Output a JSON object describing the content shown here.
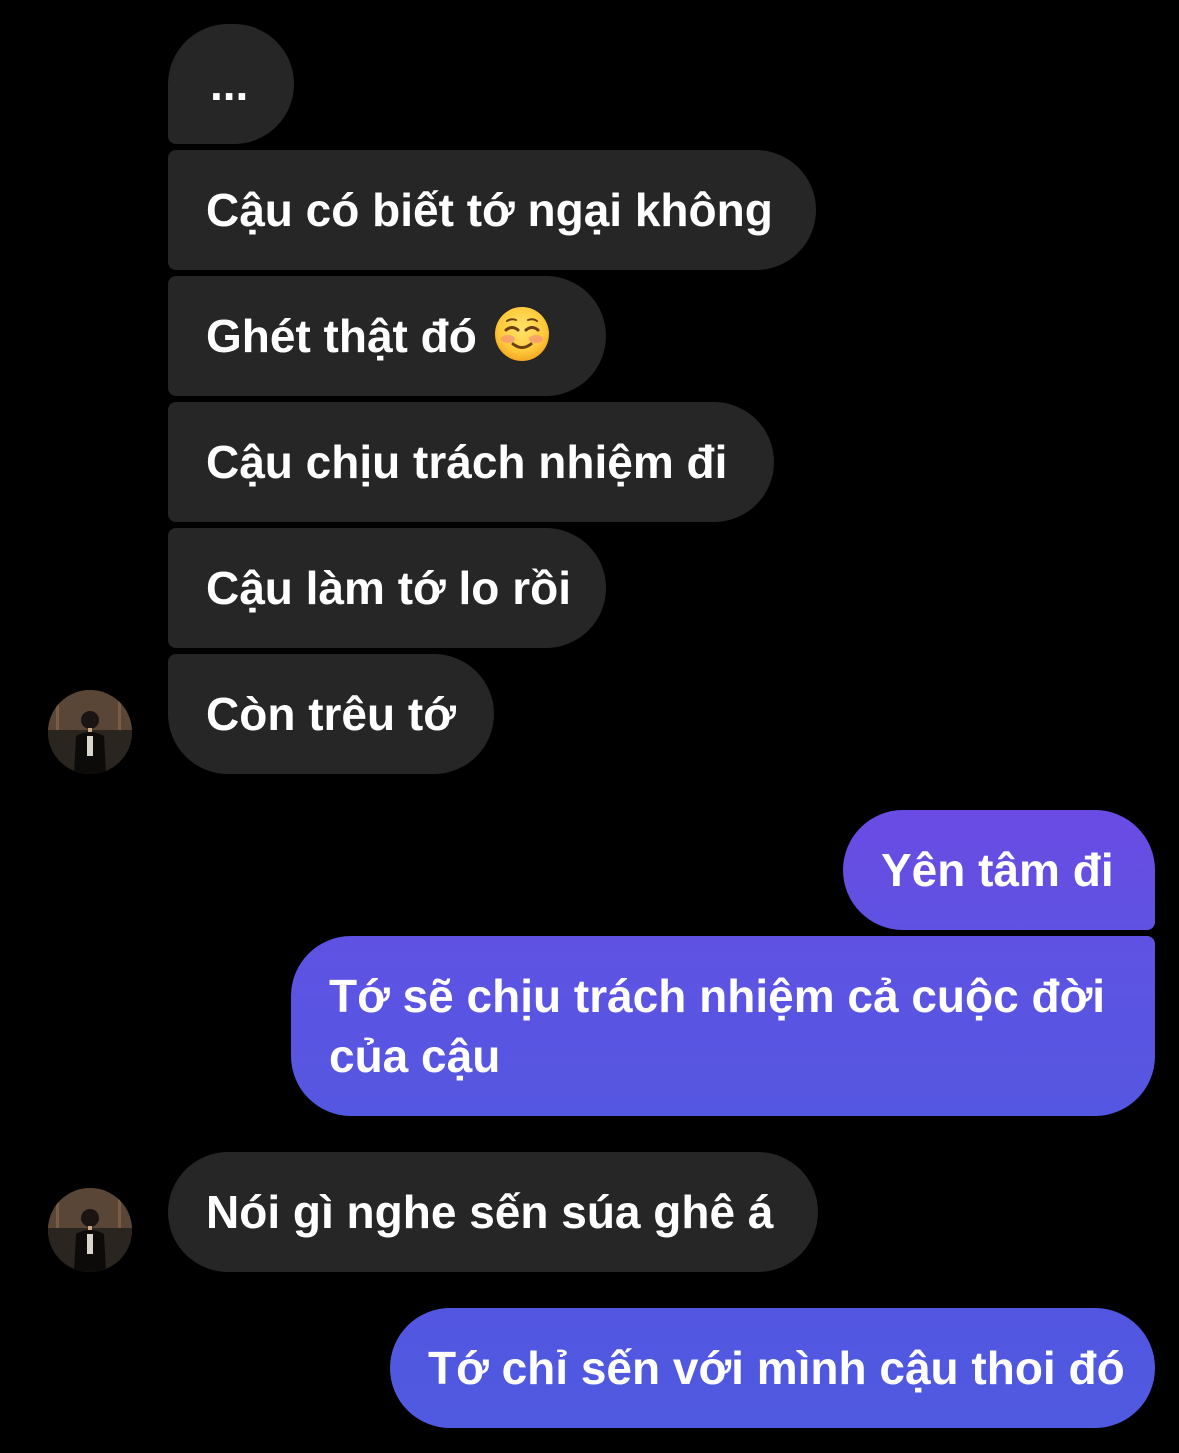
{
  "conversation": {
    "messages": [
      {
        "from": "them",
        "text": "..."
      },
      {
        "from": "them",
        "text": "Cậu có biết tớ ngại không"
      },
      {
        "from": "them",
        "text": "Ghét thật đó",
        "emoji": "smiling-face-with-blush-emoji"
      },
      {
        "from": "them",
        "text": "Cậu chịu trách nhiệm đi"
      },
      {
        "from": "them",
        "text": "Cậu làm tớ lo rồi"
      },
      {
        "from": "them",
        "text": "Còn trêu tớ"
      },
      {
        "from": "me",
        "text": "Yên tâm đi"
      },
      {
        "from": "me",
        "text_line1": "Tớ sẽ chịu trách nhiệm cả cuộc đời",
        "text_line2": "của cậu"
      },
      {
        "from": "them",
        "text": "Nói gì nghe sến súa ghê á"
      },
      {
        "from": "me",
        "text": "Tớ chỉ sến với mình cậu thoi đó"
      }
    ]
  },
  "colors": {
    "background": "#000000",
    "incoming_bubble": "#262626",
    "outgoing_gradient_top": "#6a4be3",
    "outgoing_gradient_bottom": "#4f5ae0",
    "text": "#ffffff"
  }
}
